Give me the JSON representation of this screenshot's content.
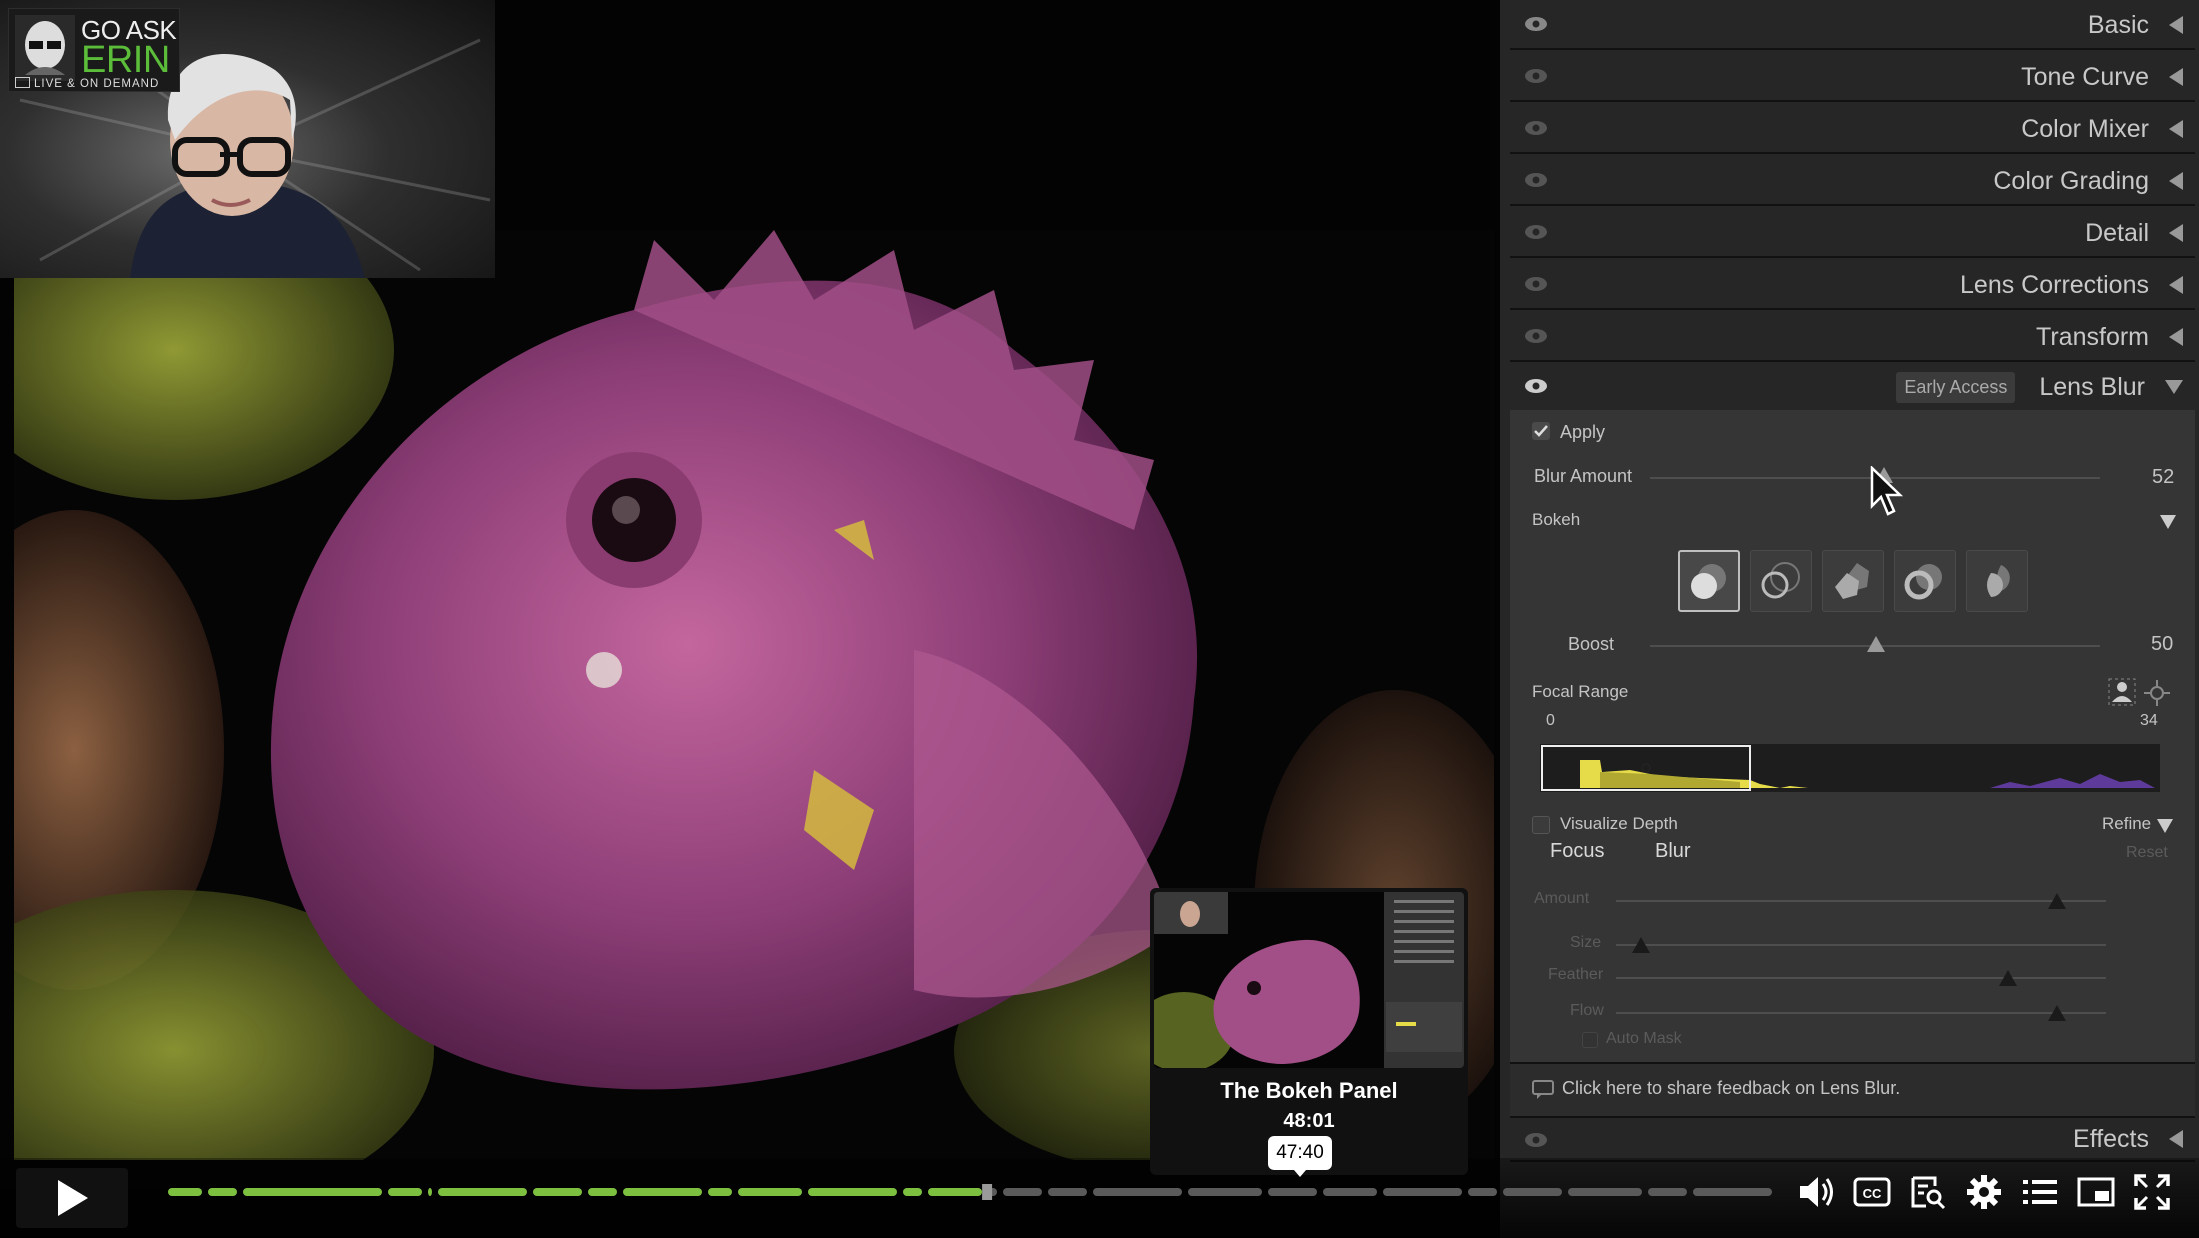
{
  "logo": {
    "line1": "GO ASK",
    "line2": "ERIN",
    "tagline": "LIVE & ON DEMAND"
  },
  "panel": {
    "sections": [
      {
        "label": "Basic"
      },
      {
        "label": "Tone Curve"
      },
      {
        "label": "Color Mixer"
      },
      {
        "label": "Color Grading"
      },
      {
        "label": "Detail"
      },
      {
        "label": "Lens Corrections"
      },
      {
        "label": "Transform"
      }
    ],
    "lens_blur": {
      "badge": "Early Access",
      "title": "Lens Blur",
      "apply_label": "Apply",
      "apply_checked": true,
      "blur_amount_label": "Blur Amount",
      "blur_amount_value": "52",
      "bokeh_label": "Bokeh",
      "boost_label": "Boost",
      "boost_value": "50",
      "focal_range_label": "Focal Range",
      "focal_min": "0",
      "focal_max": "34",
      "visualize_depth_label": "Visualize Depth",
      "refine_label": "Refine",
      "focus_tab": "Focus",
      "blur_tab": "Blur",
      "reset_label": "Reset",
      "refine_sliders": [
        {
          "label": "Amount",
          "level": 0.9
        },
        {
          "label": "Size",
          "level": 0.05
        },
        {
          "label": "Feather",
          "level": 0.8
        },
        {
          "label": "Flow",
          "level": 0.9
        }
      ],
      "auto_mask_label": "Auto Mask"
    },
    "feedback_text": "Click here to share feedback on Lens Blur.",
    "effects_label": "Effects"
  },
  "player": {
    "chapter_title": "The Bokeh Panel",
    "chapter_time": "48:01",
    "hover_time": "47:40",
    "played_fraction": 0.51,
    "accent_color": "#7dc03f"
  }
}
